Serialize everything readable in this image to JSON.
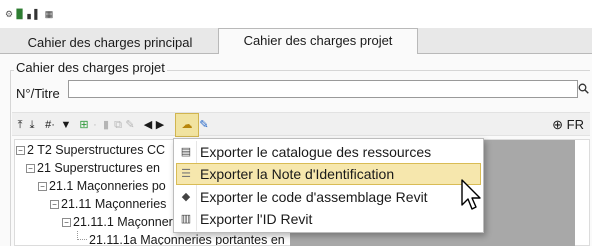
{
  "topbar": {
    "icons": [
      "settings-icon",
      "document-icon",
      "bar-chart-icon",
      "grid-icon"
    ]
  },
  "tabs": [
    {
      "label": "Cahier des charges principal",
      "active": false
    },
    {
      "label": "Cahier des charges projet",
      "active": true
    }
  ],
  "panel": {
    "group_title": "Cahier des charges projet",
    "search": {
      "label": "N°/Titre",
      "value": ""
    }
  },
  "toolbar": {
    "hash_label": "#·",
    "language": "FR",
    "colors": {
      "accent": "#f1e3a0",
      "green": "#2e9a3a",
      "blue": "#1e63c8"
    }
  },
  "tree": {
    "rows": [
      {
        "label": "2 T2 Superstructures CC"
      },
      {
        "label": "21 Superstructures en"
      },
      {
        "label": "21.1 Maçonneries po"
      },
      {
        "label": "21.11 Maçonneries"
      },
      {
        "label": "21.11.1 Maçonner"
      },
      {
        "label": "21.11.1a Maçonneries portantes en"
      }
    ]
  },
  "menu": {
    "items": [
      {
        "label": "Exporter le catalogue des ressources",
        "icon": "catalog-icon"
      },
      {
        "label": "Exporter la Note d'Identification",
        "icon": "list-icon"
      },
      {
        "label": "Exporter le code d'assemblage Revit",
        "icon": "tag-icon"
      },
      {
        "label": "Exporter l'ID Revit",
        "icon": "barcode-icon"
      }
    ],
    "hover_color": "#f6e7ad"
  }
}
